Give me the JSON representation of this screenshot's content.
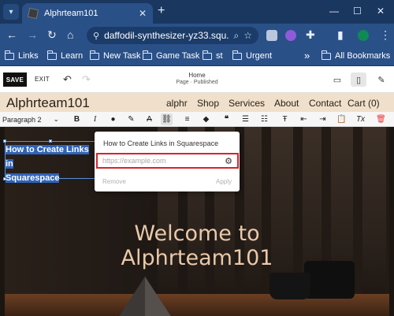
{
  "browser": {
    "tab_title": "Alphrteam101",
    "url": "daffodil-synthesizer-yz33.squ...",
    "bookmarks": [
      "Links",
      "Learn",
      "New Task",
      "Game Task",
      "st",
      "Urgent"
    ],
    "all_bookmarks": "All Bookmarks",
    "overflow": "»"
  },
  "editor": {
    "save_label": "SAVE",
    "exit_label": "EXIT",
    "page_name": "Home",
    "page_status": "Page · Published"
  },
  "site": {
    "title": "Alphrteam101",
    "nav": [
      "alphr",
      "Shop",
      "Services",
      "About",
      "Contact",
      "Cart (0)"
    ]
  },
  "toolbar": {
    "paragraph_style": "Paragraph 2"
  },
  "content": {
    "selected_line1": "How to Create Links in",
    "selected_line2": "Squarespace",
    "hero_line1": "Welcome to",
    "hero_line2": "Alphrteam101"
  },
  "link_popup": {
    "title": "How to Create Links in Squarespace",
    "placeholder": "https://example.com",
    "remove_label": "Remove",
    "apply_label": "Apply"
  },
  "colors": {
    "chrome_dark": "#1a3760",
    "chrome_light": "#2a5088",
    "site_header": "#f0dfca",
    "hero_text": "#e9c9a9",
    "highlight": "#d6242a",
    "selection": "#2f64b8"
  }
}
